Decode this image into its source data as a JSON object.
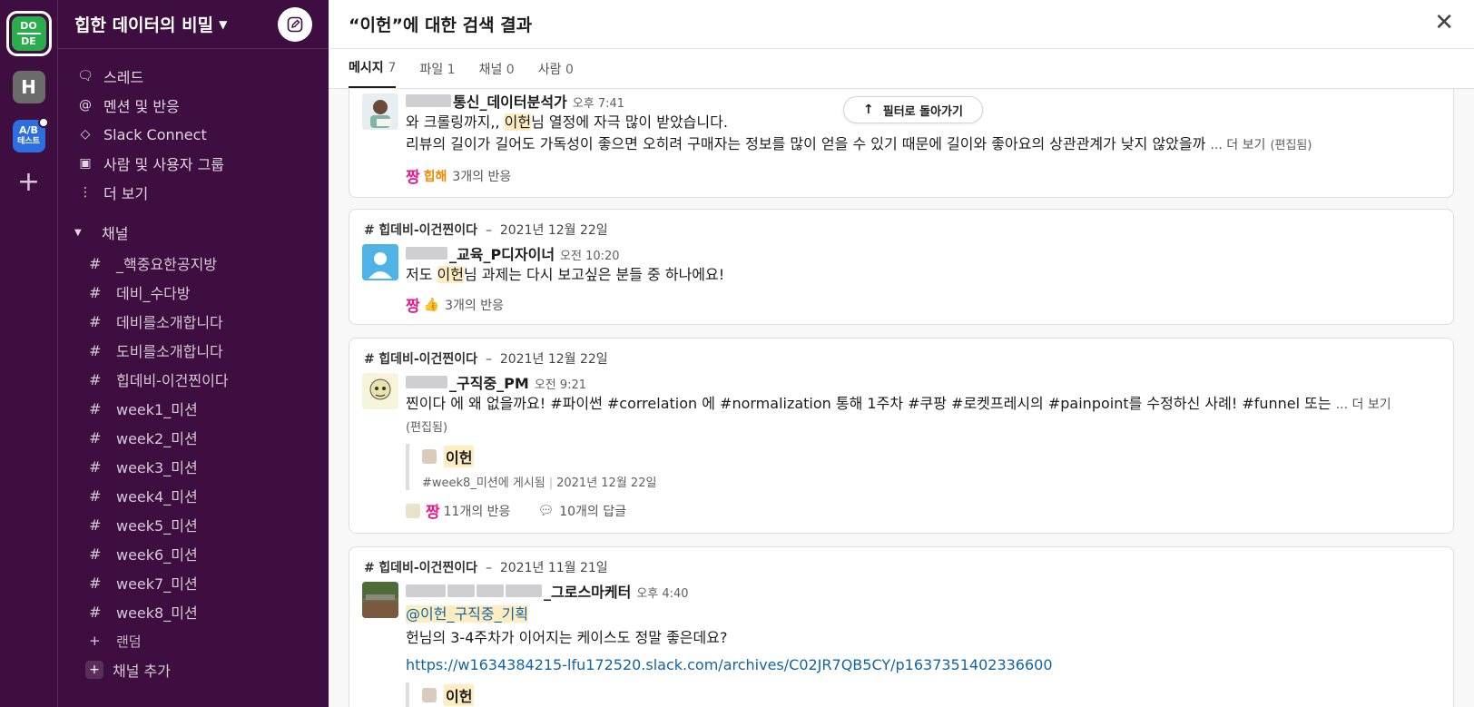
{
  "workspace_rail": {
    "active_logo_lines": [
      "DO",
      "DE"
    ],
    "h_label": "H",
    "ab_lines": [
      "A/B",
      "테스트"
    ],
    "add_label": "+"
  },
  "sidebar": {
    "workspace_name": "힙한 데이터의 비밀",
    "caret": "⌄",
    "nav": [
      {
        "icon": "threads-icon",
        "label": "스레드"
      },
      {
        "icon": "mention-icon",
        "label": "멘션 및 반응"
      },
      {
        "icon": "slack-connect-icon",
        "label": "Slack Connect"
      },
      {
        "icon": "people-icon",
        "label": "사람 및 사용자 그룹"
      },
      {
        "icon": "more-icon",
        "label": "더 보기"
      }
    ],
    "channels_section": "채널",
    "channels": [
      "_핵중요한공지방",
      "데비_수다방",
      "데비를소개합니다",
      "도비를소개합니다",
      "힙데비-이건찐이다",
      "week1_미션",
      "week2_미션",
      "week3_미션",
      "week4_미션",
      "week5_미션",
      "week6_미션",
      "week7_미션",
      "week8_미션"
    ],
    "random": "랜덤",
    "add_channel": "채널 추가"
  },
  "search": {
    "title": "“이헌”에 대한 검색 결과",
    "tabs": [
      {
        "label": "메시지",
        "count": "7",
        "active": true
      },
      {
        "label": "파일",
        "count": "1",
        "active": false
      },
      {
        "label": "채널",
        "count": "0",
        "active": false
      },
      {
        "label": "사람",
        "count": "0",
        "active": false
      }
    ],
    "back_to_filter": "필터로 돌아가기"
  },
  "results": [
    {
      "username": "통신_데이터분석가",
      "time": "오후 7:41",
      "text_before": "와 크롤링까지,, ",
      "highlight": "이헌",
      "text_after": "님 열정에 자극 많이 받았습니다.",
      "line2": "리뷰의 길이가 길어도 가독성이 좋으면 오히려 구매자는 정보를 많이 얻을 수 있기 때문에 길이와 좋아요의 상관관계가 낮지 않았을까",
      "more": "... 더 보기",
      "edited": "(편집됨)",
      "reaction1": "짱",
      "reaction2": "힙해",
      "reactions": "3개의 반응"
    },
    {
      "channel": "힙데비-이건찐이다",
      "date": "2021년 12월 22일",
      "username": "_교육_P디자이너",
      "time": "오전 10:20",
      "text_before": "저도 ",
      "highlight": "이헌",
      "text_after": "님 과제는 다시 보고싶은 분들 중 하나에요!",
      "reaction1": "짱",
      "reaction2": "👍",
      "reactions": "3개의 반응"
    },
    {
      "channel": "힙데비-이건찐이다",
      "date": "2021년 12월 22일",
      "username": "_구직중_PM",
      "time": "오전 9:21",
      "text": "찐이다 에 왜 없을까요! #파이썬 #correlation 에 #normalization 통해 1주차 #쿠팡 #로켓프레시의 #painpoint를 수정하신 사례! #funnel 또는",
      "more": "... 더 보기",
      "edited": "(편집됨)",
      "quote_name": "이헌",
      "quote_channel": "#week8_미션에 게시됨",
      "quote_date": "2021년 12월 22일",
      "reaction1": "짱",
      "reactions": "11개의 반응",
      "replies": "10개의 답글"
    },
    {
      "channel": "힙데비-이건찐이다",
      "date": "2021년 11월 21일",
      "username": "_그로스마케터",
      "time": "오후 4:40",
      "mention": "@이헌_구직중_기획",
      "text": "헌님의 3-4주차가 이어지는 케이스도 정말 좋은데요?",
      "link": "https://w1634384215-lfu172520.slack.com/archives/C02JR7QB5CY/p1637351402336600",
      "quote_name": "이헌"
    }
  ],
  "colors": {
    "sidebar_bg": "#3f0e40",
    "highlight": "#fdedc1",
    "link": "#1264a3",
    "reaction_pink": "#e01e8a"
  }
}
